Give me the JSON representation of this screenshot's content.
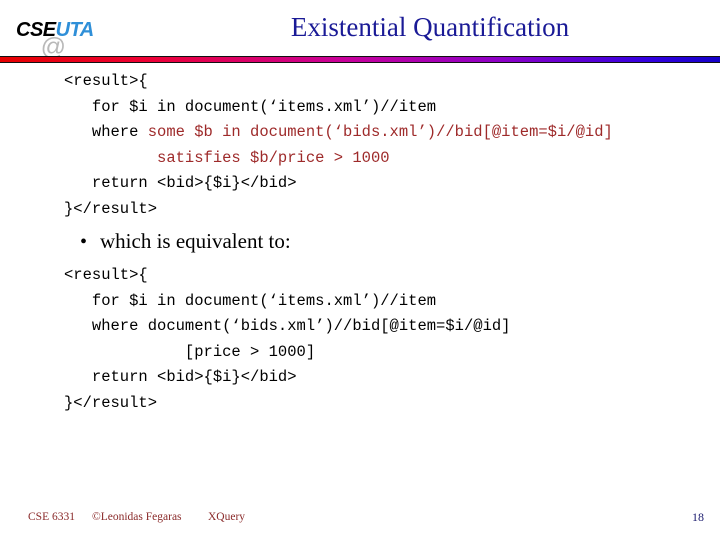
{
  "header": {
    "logo": {
      "name": "CSE@UTA",
      "part_cse": "CSE",
      "part_at": "@",
      "part_uta": "UTA"
    },
    "title": "Existential Quantification",
    "rule_gradient_from": "#e60000",
    "rule_gradient_to": "#1400c8",
    "title_color": "#1a1a96"
  },
  "body": {
    "code_block_1": {
      "highlight_color": "#9e2a2a",
      "lines": [
        {
          "indent": 0,
          "segments": [
            {
              "text": "<result>{",
              "color": "black"
            }
          ]
        },
        {
          "indent": 3,
          "segments": [
            {
              "text": "for $i in document(‘items.xml’)//item",
              "color": "black"
            }
          ]
        },
        {
          "indent": 3,
          "segments": [
            {
              "text": "where ",
              "color": "black"
            },
            {
              "text": "some $b in document(‘bids.xml’)//bid[@item=$i/@id]",
              "color": "red"
            }
          ]
        },
        {
          "indent": 10,
          "segments": [
            {
              "text": "satisfies $b/price > 1000",
              "color": "red"
            }
          ]
        },
        {
          "indent": 3,
          "segments": [
            {
              "text": "return <bid>{$i}</bid>",
              "color": "black"
            }
          ]
        },
        {
          "indent": 0,
          "segments": [
            {
              "text": "}</result>",
              "color": "black"
            }
          ]
        }
      ]
    },
    "bullet": {
      "marker": "•",
      "text": "which is equivalent to:"
    },
    "code_block_2": {
      "lines": [
        {
          "indent": 0,
          "segments": [
            {
              "text": "<result>{",
              "color": "black"
            }
          ]
        },
        {
          "indent": 3,
          "segments": [
            {
              "text": "for $i in document(‘items.xml’)//item",
              "color": "black"
            }
          ]
        },
        {
          "indent": 3,
          "segments": [
            {
              "text": "where document(‘bids.xml’)//bid[@item=$i/@id]",
              "color": "black"
            }
          ]
        },
        {
          "indent": 13,
          "segments": [
            {
              "text": "[price > 1000]",
              "color": "black"
            }
          ]
        },
        {
          "indent": 3,
          "segments": [
            {
              "text": "return <bid>{$i}</bid>",
              "color": "black"
            }
          ]
        },
        {
          "indent": 0,
          "segments": [
            {
              "text": "}</result>",
              "color": "black"
            }
          ]
        }
      ]
    }
  },
  "footer": {
    "course": "CSE 6331",
    "author": "©Leonidas Fegaras",
    "topic": "XQuery",
    "page_number": "18",
    "text_color": "#8a2a2a",
    "page_number_color": "#1a1a6e"
  }
}
